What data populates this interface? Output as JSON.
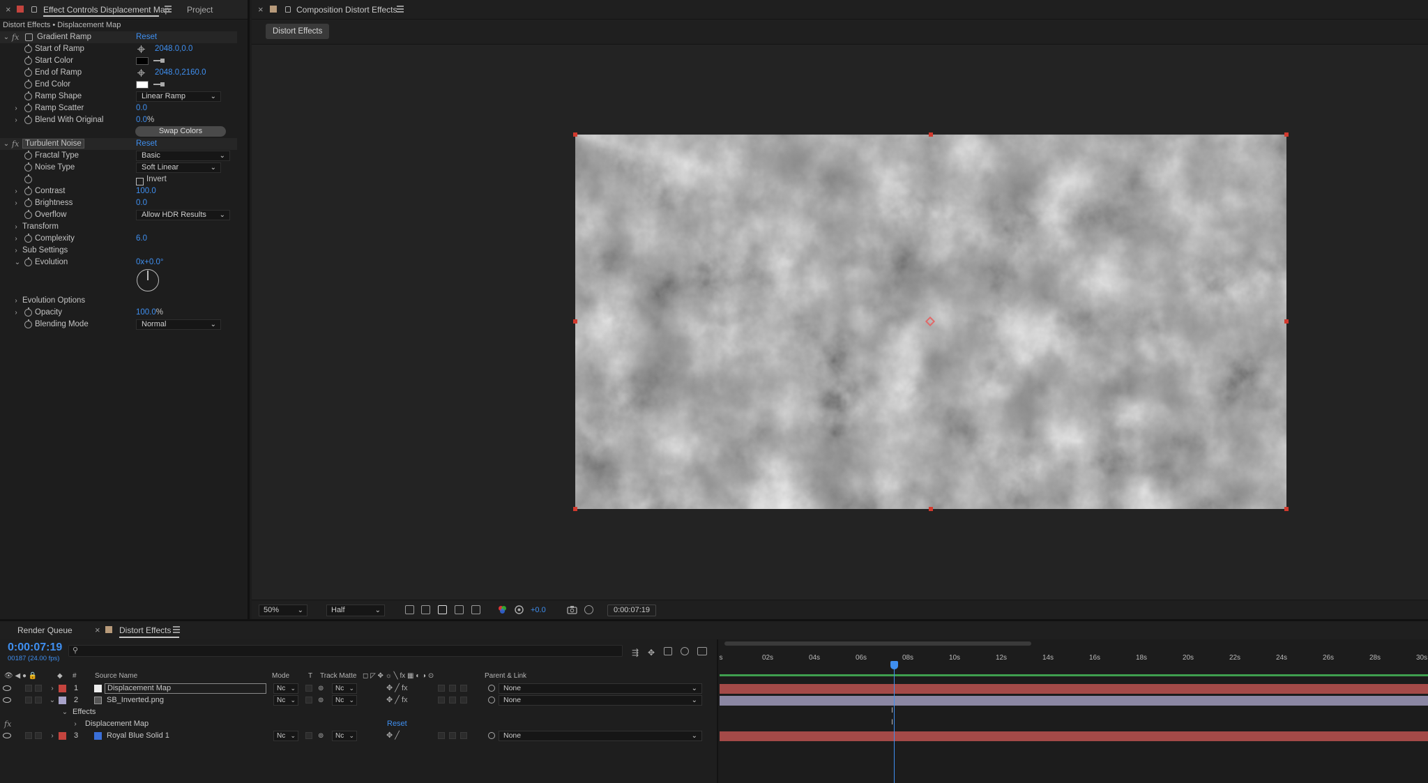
{
  "effect_controls": {
    "tab_title": "Effect Controls Displacement Map",
    "project_tab": "Project",
    "subtitle": "Distort Effects • Displacement Map",
    "gradient_ramp": {
      "name": "Gradient Ramp",
      "reset": "Reset",
      "start_of_ramp_label": "Start of Ramp",
      "start_of_ramp_value": "2048.0,0.0",
      "start_color_label": "Start Color",
      "end_of_ramp_label": "End of Ramp",
      "end_of_ramp_value": "2048.0,2160.0",
      "end_color_label": "End Color",
      "ramp_shape_label": "Ramp Shape",
      "ramp_shape_value": "Linear Ramp",
      "ramp_scatter_label": "Ramp Scatter",
      "ramp_scatter_value": "0.0",
      "blend_label": "Blend With Original",
      "blend_value": "0.0",
      "blend_unit": "%",
      "swap_colors": "Swap Colors",
      "start_color": "#000000",
      "end_color": "#ffffff"
    },
    "turbulent_noise": {
      "name": "Turbulent Noise",
      "reset": "Reset",
      "fractal_type_label": "Fractal Type",
      "fractal_type_value": "Basic",
      "noise_type_label": "Noise Type",
      "noise_type_value": "Soft Linear",
      "invert_label": "Invert",
      "contrast_label": "Contrast",
      "contrast_value": "100.0",
      "brightness_label": "Brightness",
      "brightness_value": "0.0",
      "overflow_label": "Overflow",
      "overflow_value": "Allow HDR Results",
      "transform_label": "Transform",
      "complexity_label": "Complexity",
      "complexity_value": "6.0",
      "sub_settings_label": "Sub Settings",
      "evolution_label": "Evolution",
      "evolution_value": "0x+0.0°",
      "evolution_options_label": "Evolution Options",
      "opacity_label": "Opacity",
      "opacity_value": "100.0",
      "opacity_unit": "%",
      "blending_mode_label": "Blending Mode",
      "blending_mode_value": "Normal"
    }
  },
  "composition": {
    "tab_title": "Composition Distort Effects",
    "chip": "Distort Effects",
    "zoom": "50%",
    "resolution": "Half",
    "exposure": "+0.0",
    "timecode": "0:00:07:19"
  },
  "timeline": {
    "render_queue_tab": "Render Queue",
    "comp_tab": "Distort Effects",
    "current_time": "0:00:07:19",
    "frame_info": "00187 (24.00 fps)",
    "search_icon_glyph": "⚲",
    "columns": {
      "num": "#",
      "source_name": "Source Name",
      "mode": "Mode",
      "t": "T",
      "track_matte": "Track Matte",
      "parent": "Parent & Link"
    },
    "layers": [
      {
        "num": "1",
        "name": "Displacement Map",
        "mode": "Nc",
        "matte": "Nc",
        "parent": "None",
        "label_color": "#c4443e"
      },
      {
        "num": "2",
        "name": "SB_Inverted.png",
        "mode": "Nc",
        "matte": "Nc",
        "parent": "None",
        "label_color": "#a7a2c8"
      },
      {
        "num": "3",
        "name": "Royal Blue Solid 1",
        "mode": "Nc",
        "matte": "Nc",
        "parent": "None",
        "label_color": "#c4443e"
      }
    ],
    "effects_label": "Effects",
    "effect_item": "Displacement Map",
    "effect_reset": "Reset",
    "ruler_ticks": [
      "s",
      "02s",
      "04s",
      "06s",
      "08s",
      "10s",
      "12s",
      "14s",
      "16s",
      "18s",
      "20s",
      "22s",
      "24s",
      "26s",
      "28s",
      "30s"
    ],
    "bar_colors": {
      "layer1": "#a44a48",
      "layer2": "#8b87a3",
      "layer3": "#a44a48",
      "track": "#3f9f4f"
    }
  }
}
